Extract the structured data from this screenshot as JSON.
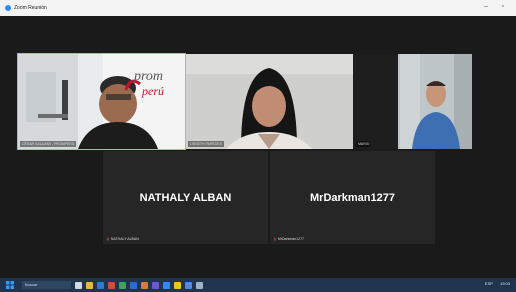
{
  "window": {
    "title": "Zoom Reunión",
    "minimize": "–",
    "maximize": "▫"
  },
  "participants": {
    "p1": {
      "name": "CÉSAR SALAZAR - PROMPERÚ",
      "logo_text_1": "prom",
      "logo_text_2": "perú"
    },
    "p2": {
      "name": "LISSETH PAREDES"
    },
    "p3": {
      "name": "MARIO"
    },
    "p4": {
      "name": "NATHALY ALBAN",
      "tag": "NATHALY ALBAN"
    },
    "p5": {
      "name": "MrDarkman1277",
      "tag": "MrDarkman1277"
    }
  },
  "taskbar": {
    "search_label": "Buscar",
    "time": "19:03",
    "lang": "ESP"
  },
  "colors": {
    "active_speaker": "#a6d33b",
    "taskbar": "#20354d",
    "mic_muted": "#e03b3b"
  }
}
